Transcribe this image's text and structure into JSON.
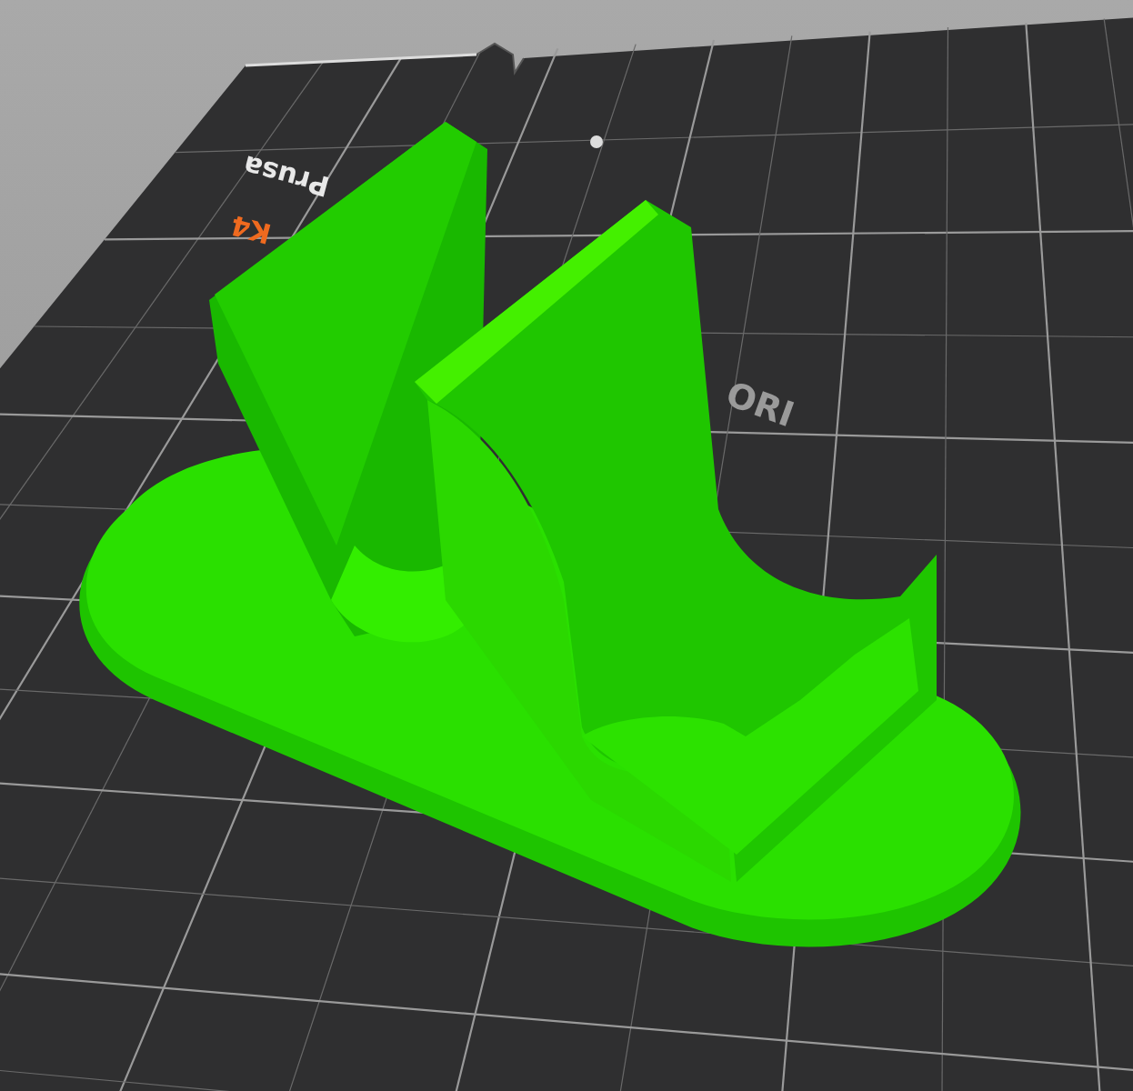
{
  "viewport": {
    "bed": {
      "labels": [
        {
          "kind": "brand",
          "text": "Prusa"
        },
        {
          "kind": "model",
          "text": "K4"
        },
        {
          "kind": "edition",
          "text": "ORI"
        }
      ]
    }
  }
}
